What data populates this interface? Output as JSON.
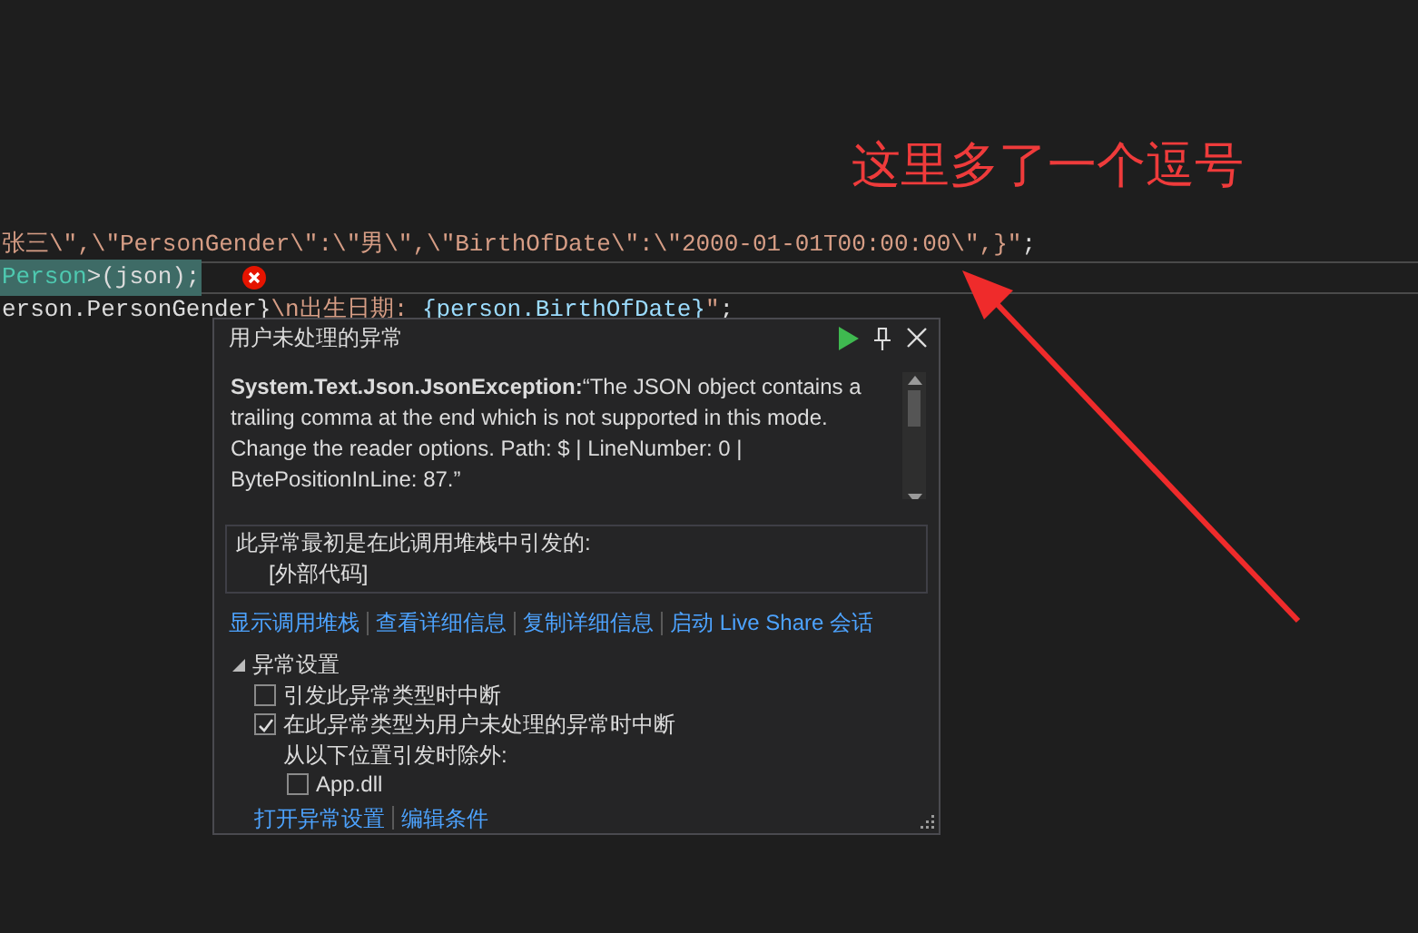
{
  "annotation": {
    "text": "这里多了一个逗号"
  },
  "code_lines": [
    {
      "highlighted": false,
      "error": false,
      "segments": [
        {
          "kind": "string",
          "text": "张三\\\",\\\"PersonGender\\\":\\\"男\\\",\\\"BirthOfDate\\\":\\\"2000-01-01T00:00:00\\\",}\""
        },
        {
          "kind": "plain",
          "text": ";"
        }
      ]
    },
    {
      "highlighted": true,
      "error": true,
      "segments": [
        {
          "kind": "type",
          "text": "Person"
        },
        {
          "kind": "plain",
          "text": ">(json);"
        }
      ]
    },
    {
      "highlighted": false,
      "error": false,
      "segments": [
        {
          "kind": "plain",
          "text": "erson.PersonGender}"
        },
        {
          "kind": "string",
          "text": "\\n出生日期: "
        },
        {
          "kind": "variable",
          "text": "{person.BirthOfDate}"
        },
        {
          "kind": "string",
          "text": "\""
        },
        {
          "kind": "plain",
          "text": ";"
        }
      ]
    }
  ],
  "popup": {
    "title": "用户未处理的异常",
    "message": "**System.Text.Json.JsonException:**“The JSON object contains a trailing comma at the end which is not supported in this mode. Change the reader options. Path: $ | LineNumber: 0 | BytePositionInLine: 87.”",
    "stack": {
      "heading": "此异常最初是在此调用堆栈中引发的:",
      "frames": [
        "[外部代码]"
      ]
    },
    "links": [
      "显示调用堆栈",
      "查看详细信息",
      "复制详细信息",
      "启动 Live Share 会话"
    ],
    "settings": {
      "title": "异常设置",
      "expanded": true,
      "options": [
        {
          "label": "引发此异常类型时中断",
          "checked": false
        },
        {
          "label": "在此异常类型为用户未处理的异常时中断",
          "checked": true
        }
      ],
      "except_label": "从以下位置引发时除外:",
      "exceptions": [
        {
          "label": "App.dll",
          "checked": false
        }
      ]
    },
    "footer_links": [
      "打开异常设置",
      "编辑条件"
    ]
  }
}
